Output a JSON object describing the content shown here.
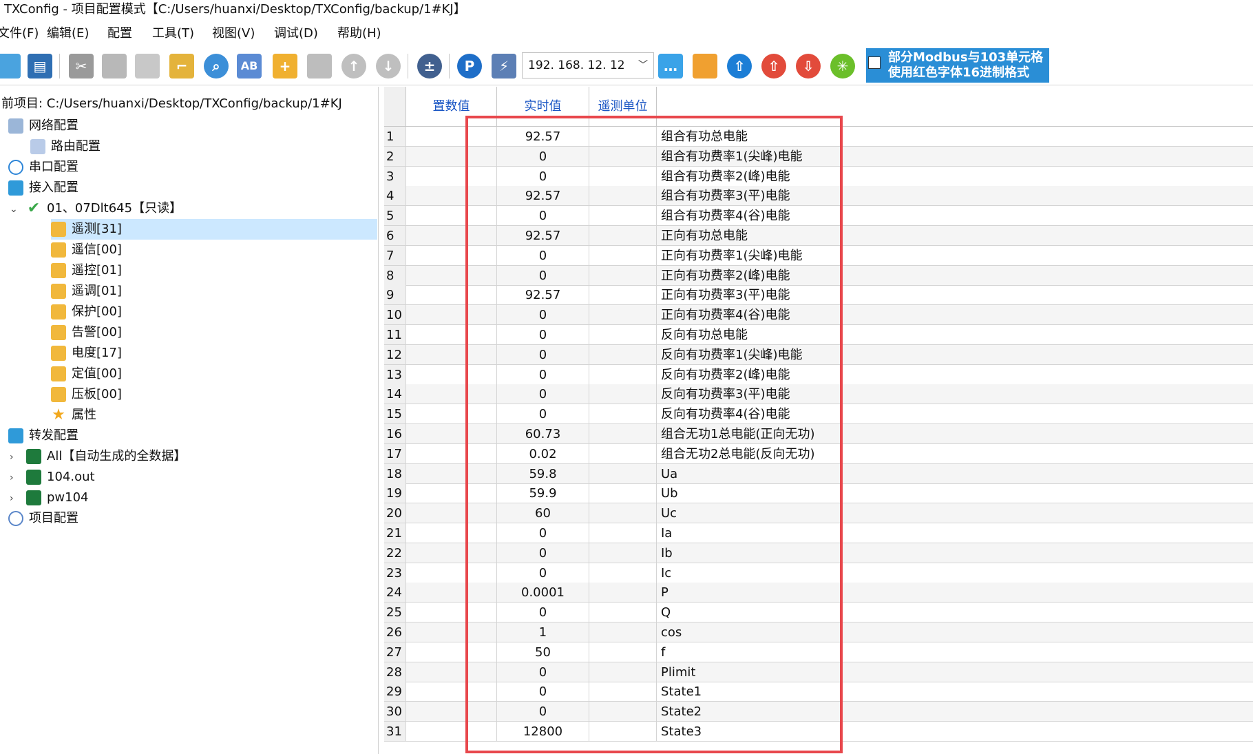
{
  "window": {
    "title": "TXConfig - 项目配置模式【C:/Users/huanxi/Desktop/TXConfig/backup/1#KJ】"
  },
  "menu": [
    "文件(F)",
    "编辑(E)",
    "配置",
    "工具(T)",
    "视图(V)",
    "调试(D)",
    "帮助(H)"
  ],
  "toolbar": {
    "ip_address": "192. 168. 12. 12",
    "banner_line1": "部分Modbus与103单元格",
    "banner_line2": "使用红色字体16进制格式",
    "icons": [
      "new-icon",
      "save-icon",
      "cut-icon",
      "copy-icon",
      "paste-icon",
      "clear-icon",
      "find-icon",
      "replace-icon",
      "add-point-icon",
      "delete-point-icon",
      "move-up-icon",
      "move-down-icon",
      "calculator-icon",
      "p-icon",
      "connect-icon",
      "message-icon",
      "tools-icon",
      "upload-icon",
      "upload-red-icon",
      "download-red-icon",
      "settings-green-icon"
    ]
  },
  "tree": {
    "current_project_label": "前项目: C:/Users/huanxi/Desktop/TXConfig/backup/1#KJ",
    "nodes": [
      {
        "label": "网络配置",
        "icon": "network-icon",
        "level": 0
      },
      {
        "label": "路由配置",
        "icon": "route-icon",
        "level": 1
      },
      {
        "label": "串口配置",
        "icon": "serial-icon",
        "level": 0
      },
      {
        "label": "接入配置",
        "icon": "access-icon",
        "level": 0
      },
      {
        "label": "01、07Dlt645【只读】",
        "icon": "check-icon",
        "level": 1,
        "expanded": true
      },
      {
        "label": "遥测[31]",
        "icon": "chart-icon",
        "level": 2,
        "selected": true
      },
      {
        "label": "遥信[00]",
        "icon": "chart-icon",
        "level": 2
      },
      {
        "label": "遥控[01]",
        "icon": "chart-icon",
        "level": 2
      },
      {
        "label": "遥调[01]",
        "icon": "chart-icon",
        "level": 2
      },
      {
        "label": "保护[00]",
        "icon": "chart-icon",
        "level": 2
      },
      {
        "label": "告警[00]",
        "icon": "chart-icon",
        "level": 2
      },
      {
        "label": "电度[17]",
        "icon": "chart-icon",
        "level": 2
      },
      {
        "label": "定值[00]",
        "icon": "chart-icon",
        "level": 2
      },
      {
        "label": "压板[00]",
        "icon": "chart-icon",
        "level": 2
      },
      {
        "label": "属性",
        "icon": "star-icon",
        "level": 2
      },
      {
        "label": "转发配置",
        "icon": "forward-icon",
        "level": 0
      },
      {
        "label": "All【自动生成的全数据】",
        "icon": "excel-icon",
        "level": 1,
        "collapsed": true
      },
      {
        "label": "104.out",
        "icon": "excel-icon",
        "level": 1,
        "collapsed": true
      },
      {
        "label": "pw104",
        "icon": "excel-icon",
        "level": 1,
        "collapsed": true
      },
      {
        "label": "项目配置",
        "icon": "user-icon",
        "level": 0
      }
    ]
  },
  "grid": {
    "columns": [
      "置数值",
      "实时值",
      "遥测单位"
    ],
    "rows": [
      {
        "idx": "1",
        "value": "92.57",
        "name": "组合有功总电能"
      },
      {
        "idx": "2",
        "value": "0",
        "name": "组合有功费率1(尖峰)电能"
      },
      {
        "idx": "3",
        "value": "0",
        "name": "组合有功费率2(峰)电能"
      },
      {
        "idx": "4",
        "value": "92.57",
        "name": "组合有功费率3(平)电能"
      },
      {
        "idx": "5",
        "value": "0",
        "name": "组合有功费率4(谷)电能"
      },
      {
        "idx": "6",
        "value": "92.57",
        "name": "正向有功总电能"
      },
      {
        "idx": "7",
        "value": "0",
        "name": "正向有功费率1(尖峰)电能"
      },
      {
        "idx": "8",
        "value": "0",
        "name": "正向有功费率2(峰)电能"
      },
      {
        "idx": "9",
        "value": "92.57",
        "name": "正向有功费率3(平)电能"
      },
      {
        "idx": "10",
        "value": "0",
        "name": "正向有功费率4(谷)电能"
      },
      {
        "idx": "11",
        "value": "0",
        "name": "反向有功总电能"
      },
      {
        "idx": "12",
        "value": "0",
        "name": "反向有功费率1(尖峰)电能"
      },
      {
        "idx": "13",
        "value": "0",
        "name": "反向有功费率2(峰)电能"
      },
      {
        "idx": "14",
        "value": "0",
        "name": "反向有功费率3(平)电能"
      },
      {
        "idx": "15",
        "value": "0",
        "name": "反向有功费率4(谷)电能"
      },
      {
        "idx": "16",
        "value": "60.73",
        "name": "组合无功1总电能(正向无功)"
      },
      {
        "idx": "17",
        "value": "0.02",
        "name": "组合无功2总电能(反向无功)"
      },
      {
        "idx": "18",
        "value": "59.8",
        "name": "Ua"
      },
      {
        "idx": "19",
        "value": "59.9",
        "name": "Ub"
      },
      {
        "idx": "20",
        "value": "60",
        "name": "Uc"
      },
      {
        "idx": "21",
        "value": "0",
        "name": "Ia"
      },
      {
        "idx": "22",
        "value": "0",
        "name": "Ib"
      },
      {
        "idx": "23",
        "value": "0",
        "name": "Ic"
      },
      {
        "idx": "24",
        "value": "0.0001",
        "name": "P"
      },
      {
        "idx": "25",
        "value": "0",
        "name": "Q"
      },
      {
        "idx": "26",
        "value": "1",
        "name": "cos"
      },
      {
        "idx": "27",
        "value": "50",
        "name": "f"
      },
      {
        "idx": "28",
        "value": "0",
        "name": "Plimit"
      },
      {
        "idx": "29",
        "value": "0",
        "name": "State1"
      },
      {
        "idx": "30",
        "value": "0",
        "name": "State2"
      },
      {
        "idx": "31",
        "value": "12800",
        "name": "State3"
      }
    ]
  },
  "colors": {
    "highlight_box": "#e8474c",
    "header_text": "#1a56c4",
    "selection": "#cce8ff",
    "banner": "#2a8ed6"
  }
}
